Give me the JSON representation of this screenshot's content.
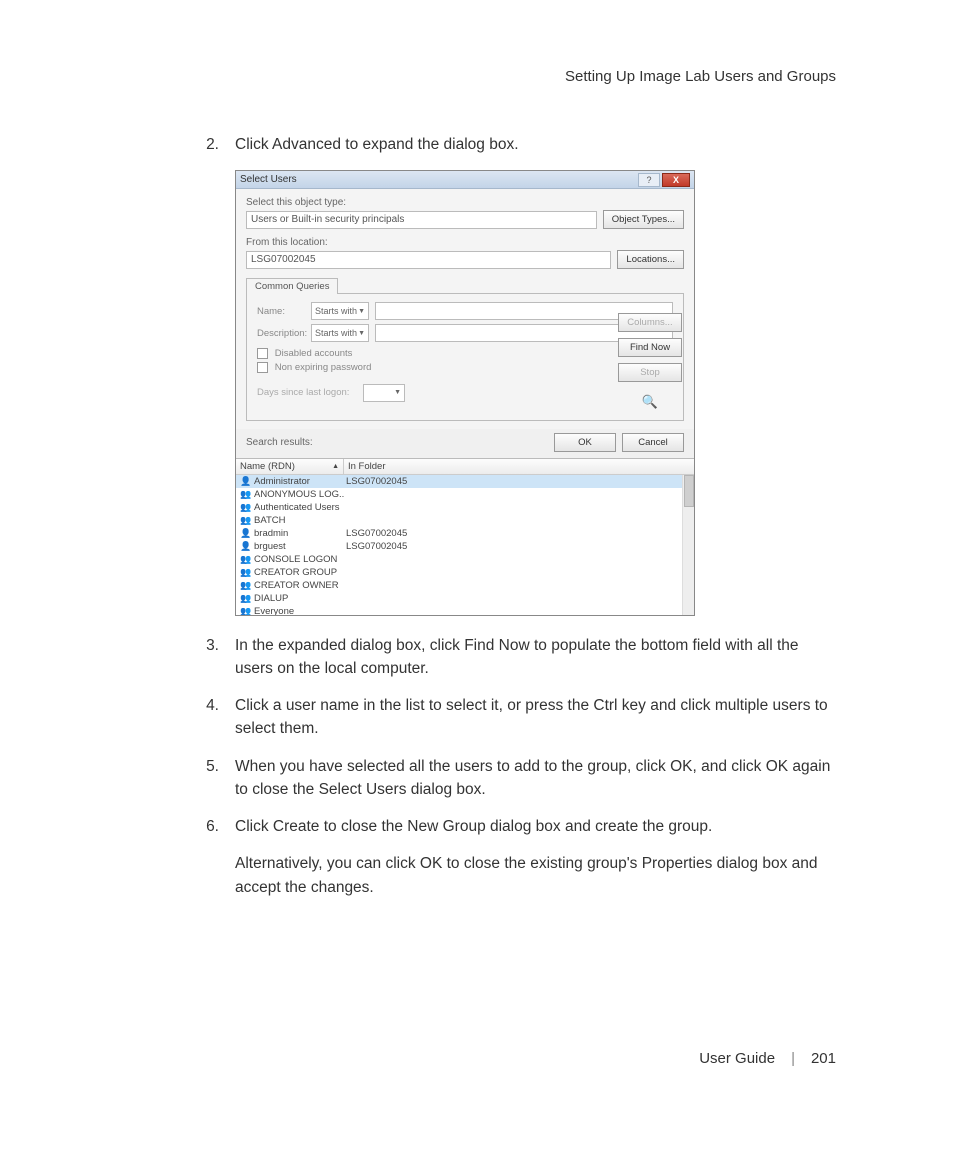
{
  "header": {
    "section_title": "Setting Up Image Lab Users and Groups"
  },
  "steps": [
    {
      "num": "2.",
      "text": "Click Advanced to expand the dialog box."
    },
    {
      "num": "3.",
      "text": "In the expanded dialog box, click Find Now to populate the bottom field with all the users on the local computer."
    },
    {
      "num": "4.",
      "text": "Click a user name in the list to select it, or press the Ctrl key and click multiple users to select them."
    },
    {
      "num": "5.",
      "text": "When you have selected all the users to add to the group, click OK, and click OK again to close the Select Users dialog box."
    },
    {
      "num": "6.",
      "text": "Click Create to close the New Group dialog box and create the group."
    }
  ],
  "alt_paragraph": "Alternatively, you can click OK to close the existing group's Properties dialog box and accept the changes.",
  "dialog": {
    "title": "Select Users",
    "labels": {
      "object_type": "Select this object type:",
      "object_value": "Users or Built-in security principals",
      "from_location": "From this location:",
      "location_value": "LSG07002045",
      "tab": "Common Queries",
      "name": "Name:",
      "description": "Description:",
      "starts_with": "Starts with",
      "disabled": "Disabled accounts",
      "nonexp": "Non expiring password",
      "days": "Days since last logon:",
      "search_results": "Search results:"
    },
    "buttons": {
      "object_types": "Object Types...",
      "locations": "Locations...",
      "columns": "Columns...",
      "find_now": "Find Now",
      "stop": "Stop",
      "ok": "OK",
      "cancel": "Cancel",
      "help": "?",
      "close": "X"
    },
    "columns": {
      "name": "Name (RDN)",
      "folder": "In Folder"
    },
    "results": [
      {
        "icon": "user",
        "name": "Administrator",
        "folder": "LSG07002045",
        "selected": true
      },
      {
        "icon": "group",
        "name": "ANONYMOUS LOG..",
        "folder": ""
      },
      {
        "icon": "group",
        "name": "Authenticated Users",
        "folder": ""
      },
      {
        "icon": "group",
        "name": "BATCH",
        "folder": ""
      },
      {
        "icon": "user",
        "name": "bradmin",
        "folder": "LSG07002045"
      },
      {
        "icon": "user",
        "name": "brguest",
        "folder": "LSG07002045"
      },
      {
        "icon": "group",
        "name": "CONSOLE LOGON",
        "folder": ""
      },
      {
        "icon": "group",
        "name": "CREATOR GROUP",
        "folder": ""
      },
      {
        "icon": "group",
        "name": "CREATOR OWNER",
        "folder": ""
      },
      {
        "icon": "group",
        "name": "DIALUP",
        "folder": ""
      },
      {
        "icon": "group",
        "name": "Everyone",
        "folder": ""
      }
    ]
  },
  "footer": {
    "label": "User Guide",
    "sep": "|",
    "page": "201"
  }
}
